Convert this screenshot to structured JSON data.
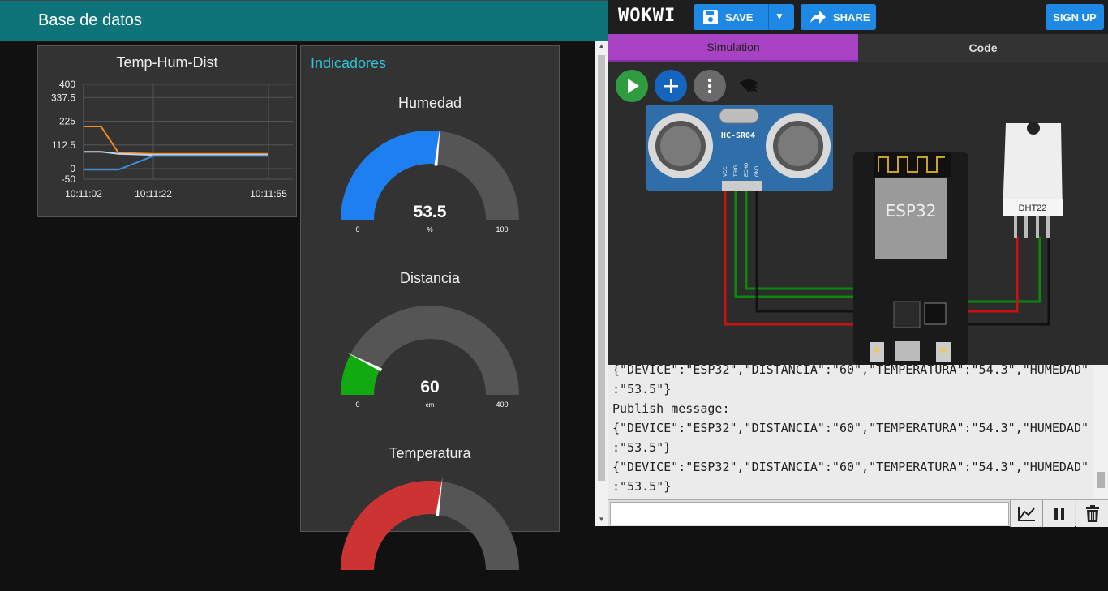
{
  "dashboard": {
    "title": "Base de datos",
    "chart": {
      "title": "Temp-Hum-Dist",
      "y_ticks": [
        "400",
        "337.5",
        "225",
        "112.5",
        "0",
        "-50"
      ],
      "x_ticks": [
        "10:11:02",
        "10:11:22",
        "10:11:55"
      ]
    },
    "indicators": {
      "title": "Indicadores",
      "gauges": [
        {
          "title": "Humedad",
          "value": "53.5",
          "unit": "%",
          "min": "0",
          "max": "100",
          "fraction": 0.535,
          "color": "#1e7ff0"
        },
        {
          "title": "Distancia",
          "value": "60",
          "unit": "cm",
          "min": "0",
          "max": "400",
          "fraction": 0.15,
          "color": "#11aa11"
        },
        {
          "title": "Temperatura",
          "value": "",
          "unit": "",
          "min": "",
          "max": "",
          "fraction": 0.543,
          "color": "#cc3333"
        }
      ]
    }
  },
  "chart_data": {
    "type": "line",
    "title": "Temp-Hum-Dist",
    "x": [
      "10:11:02",
      "10:11:07",
      "10:11:12",
      "10:11:22",
      "10:11:55"
    ],
    "ylim": [
      -50,
      400
    ],
    "grid": true,
    "series": [
      {
        "values": [
          200,
          200,
          75,
          70,
          70
        ],
        "color": "#f08a24"
      },
      {
        "values": [
          80,
          80,
          70,
          65,
          65
        ],
        "color": "#bcd6ee"
      },
      {
        "values": [
          -5,
          -5,
          -5,
          60,
          60
        ],
        "color": "#3a8dde"
      }
    ]
  },
  "wokwi": {
    "logo": "WOKWI",
    "save_label": "SAVE",
    "share_label": "SHARE",
    "signup_label": "SIGN UP",
    "tabs": [
      "Simulation",
      "Code"
    ],
    "parts": {
      "sensor_label": "HC-SR04",
      "sensor_pins": [
        "VCC",
        "TRIG",
        "ECHO",
        "GND"
      ],
      "mcu_label": "ESP32",
      "dht_label": "DHT22"
    },
    "serial_lines": [
      "{\"DEVICE\":\"ESP32\",\"DISTANCIA\":\"60\",\"TEMPERATURA\":\"54.3\",\"HUMEDAD\"",
      ":\"53.5\"}",
      "Publish message:",
      "{\"DEVICE\":\"ESP32\",\"DISTANCIA\":\"60\",\"TEMPERATURA\":\"54.3\",\"HUMEDAD\"",
      ":\"53.5\"}",
      "{\"DEVICE\":\"ESP32\",\"DISTANCIA\":\"60\",\"TEMPERATURA\":\"54.3\",\"HUMEDAD\"",
      ":\"53.5\"}"
    ],
    "serial_input_value": ""
  }
}
